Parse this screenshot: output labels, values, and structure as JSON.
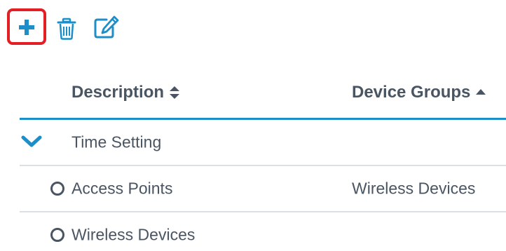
{
  "toolbar": {
    "add_icon": "plus-icon",
    "delete_icon": "trash-icon",
    "edit_icon": "edit-icon"
  },
  "table": {
    "columns": [
      {
        "label": "Description",
        "sort": "unsorted"
      },
      {
        "label": "Device Groups",
        "sort": "ascending"
      }
    ],
    "group": {
      "label": "Time Setting",
      "expanded": true
    },
    "rows": [
      {
        "description": "Access Points",
        "device_groups": "Wireless Devices"
      },
      {
        "description": "Wireless Devices",
        "device_groups": ""
      }
    ]
  },
  "colors": {
    "accent": "#1d8ec7",
    "highlight": "#e31e24",
    "text": "#4a5563",
    "divider": "#dcdfe3"
  }
}
